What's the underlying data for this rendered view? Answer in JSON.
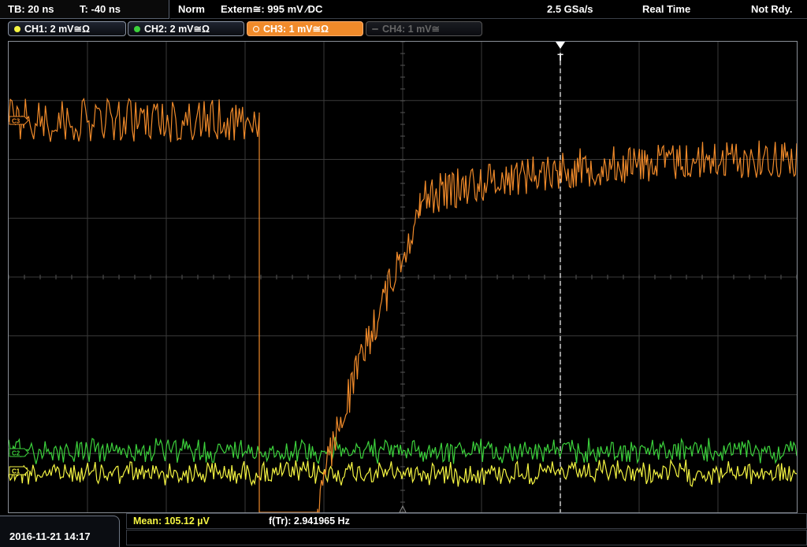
{
  "status": {
    "timebase": "TB: 20 ns",
    "trigger_offset": "T: -40 ns",
    "trigger_mode": "Norm",
    "trigger_source": "Extern≅: 995 mV ∕DC",
    "sample_rate": "2.5 GSa/s",
    "acq_mode": "Real Time",
    "ready_state": "Not Rdy."
  },
  "channels": [
    {
      "label": "CH1: 2 mV≅Ω",
      "color": "#f5f542",
      "state": "on"
    },
    {
      "label": "CH2: 2 mV≅Ω",
      "color": "#3cd23c",
      "state": "on"
    },
    {
      "label": "CH3: 1 mV≅Ω",
      "color": "#f08a2a",
      "state": "active"
    },
    {
      "label": "CH4: 1 mV≅",
      "color": "#666666",
      "state": "off"
    }
  ],
  "plot": {
    "trigger_marker": "T",
    "ch_markers": [
      "C3",
      "C2",
      "C1"
    ],
    "grid_color": "#3a3a3a",
    "trace_colors": {
      "ch1": "#f5f542",
      "ch2": "#3cd23c",
      "ch3": "#f08a2a"
    }
  },
  "bottom": {
    "datetime": "2016-11-21 14:17",
    "measurement_1": "Mean: 105.12 µV",
    "measurement_2": "f(Tr): 2.941965 Hz"
  }
}
